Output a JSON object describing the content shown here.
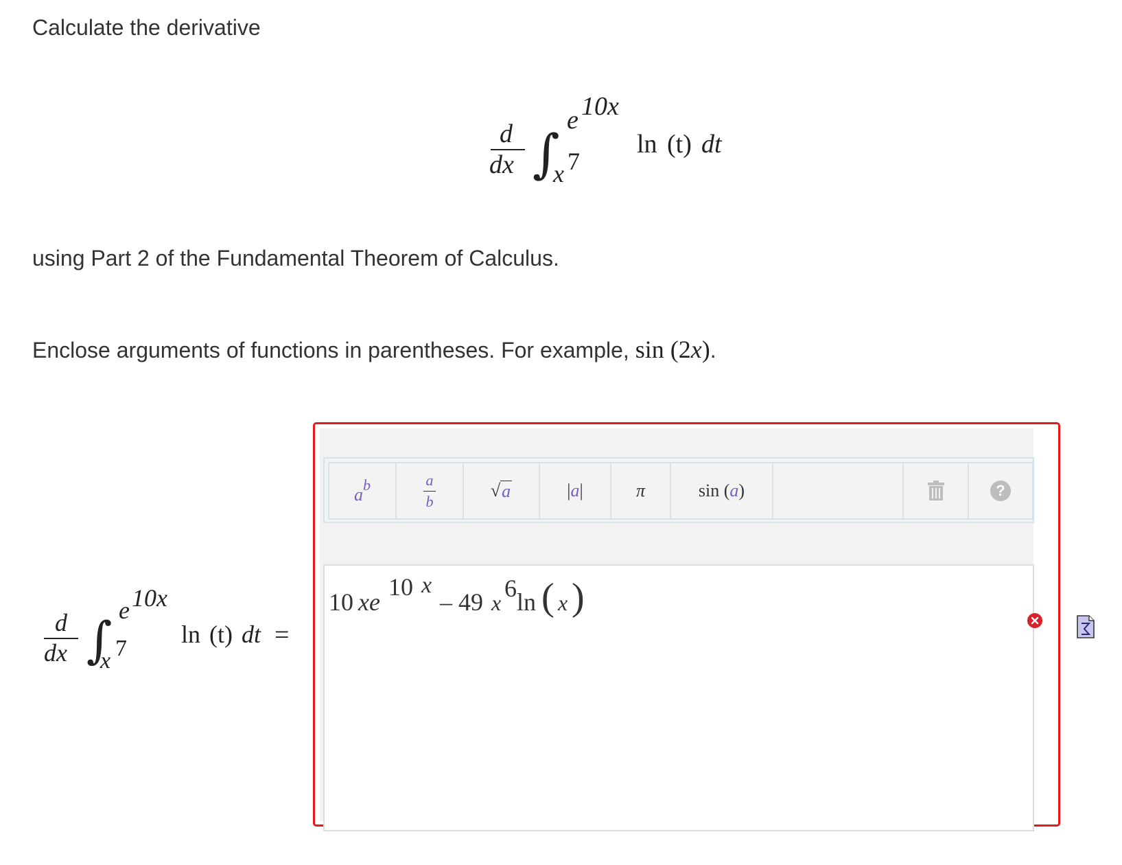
{
  "problem": {
    "intro": "Calculate the derivative",
    "method": "using Part 2 of the Fundamental Theorem of Calculus.",
    "instruction": "Enclose arguments of functions in parentheses. For example,",
    "example_fn": "sin",
    "example_arg": "(2",
    "example_var": "x",
    "example_close": ")",
    "example_period": "."
  },
  "display_math": {
    "d": "d",
    "dx": "dx",
    "integral": "∫",
    "upper_base": "e",
    "upper_exp": "10x",
    "lower_base": "x",
    "lower_exp": "7",
    "integrand_fn": "ln",
    "integrand_arg": "(t)",
    "integrand_dt": "dt"
  },
  "answer_label": {
    "equals": "="
  },
  "toolbar": {
    "power": {
      "base": "a",
      "exp": "b"
    },
    "fraction": {
      "num": "a",
      "den": "b"
    },
    "sqrt": {
      "radical": "√",
      "arg": "a"
    },
    "abs": {
      "left": "|",
      "arg": "a",
      "right": "|"
    },
    "pi": "π",
    "sin": {
      "fn": "sin",
      "open": "(",
      "arg": "a",
      "close": ")"
    },
    "trash_icon": "trash-icon",
    "help_icon": "help-icon",
    "help_glyph": "?"
  },
  "answer_input": {
    "t1_coef": "10",
    "t1_var": "xe",
    "t1_exp_num": "10",
    "t1_exp_var": "x",
    "minus": "–",
    "t2_coef": "49",
    "t2_var": "x",
    "t2_exp": "6",
    "t2_fn": "ln",
    "t2_arg": "x"
  },
  "status": {
    "result": "incorrect",
    "result_icon": "incorrect-x-icon",
    "preview_icon": "sigma-preview-icon"
  },
  "colors": {
    "error_border": "#e3191a",
    "toolbar_var": "#7a5cc4",
    "incorrect_badge": "#d8232a"
  }
}
